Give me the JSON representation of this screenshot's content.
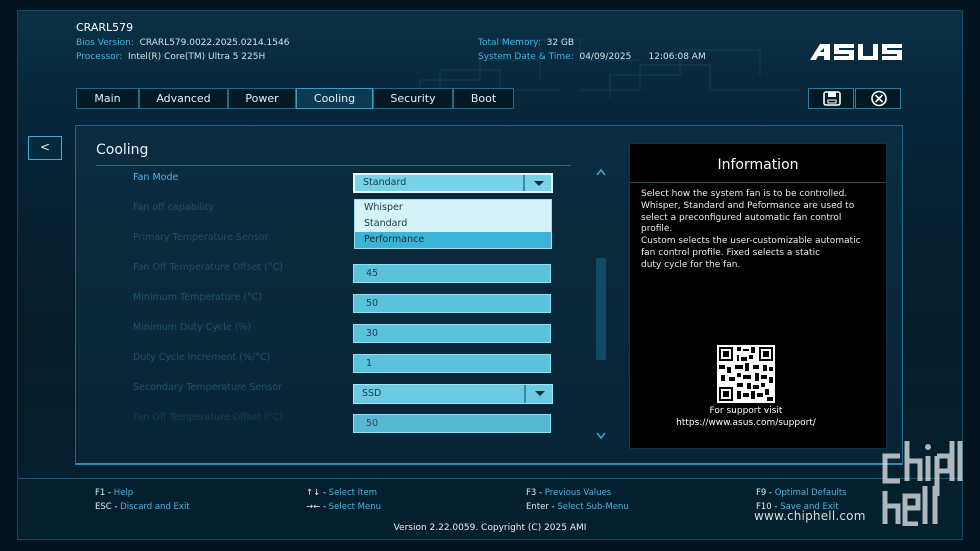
{
  "header": {
    "model": "CRARL579",
    "bios_version_label": "Bios Version:",
    "bios_version": "CRARL579.0022.2025.0214.1546",
    "processor_label": "Processor:",
    "processor": "Intel(R) Core(TM) Ultra 5 225H",
    "memory_label": "Total Memory:",
    "memory": "32 GB",
    "datetime_label": "System Date & Time:",
    "date": "04/09/2025",
    "time": "12:06:08 AM",
    "brand": "ASUS"
  },
  "tabs": [
    {
      "label": "Main"
    },
    {
      "label": "Advanced"
    },
    {
      "label": "Power"
    },
    {
      "label": "Cooling"
    },
    {
      "label": "Security"
    },
    {
      "label": "Boot"
    }
  ],
  "active_tab": "Cooling",
  "back_label": "<",
  "section": {
    "title": "Cooling",
    "rows": [
      {
        "label": "Fan Mode",
        "value": "Standard"
      },
      {
        "label": "Fan off capability",
        "value": ""
      },
      {
        "label": "Primary Temperature Sensor",
        "value": ""
      },
      {
        "label": "Fan Off Temperature Offset (°C)",
        "value": "45"
      },
      {
        "label": "Minimum Temperature (°C)",
        "value": "50"
      },
      {
        "label": "Minimum Duty Cycle (%)",
        "value": "30"
      },
      {
        "label": "Duty Cycle Increment (%/°C)",
        "value": "1"
      },
      {
        "label": "Secondary Temperature Sensor",
        "value": "SSD"
      },
      {
        "label": "Fan Off Temperature Offset (°C)",
        "value": "50"
      }
    ],
    "dropdown_options": [
      "Whisper",
      "Standard",
      "Performance"
    ],
    "highlighted_option": "Performance"
  },
  "info": {
    "title": "Information",
    "lines": [
      "Select how the system fan is to be controlled.",
      "Whisper, Standard and Peformance are used to",
      "select a preconfigured automatic fan control",
      "profile.",
      "Custom selects the user-customizable automatic",
      "fan control profile. Fixed selects a static",
      "duty cycle for the fan."
    ],
    "support_label": "For support visit",
    "support_url": "https://www.asus.com/support/"
  },
  "hotkeys": [
    {
      "key": "F1",
      "desc": "Help"
    },
    {
      "key": "ESC",
      "desc": "Discard and Exit"
    },
    {
      "key": "↑↓",
      "desc": "Select Item"
    },
    {
      "key": "→←",
      "desc": "Select Menu"
    },
    {
      "key": "F3",
      "desc": "Previous Values"
    },
    {
      "key": "Enter",
      "desc": "Select Sub-Menu"
    },
    {
      "key": "F9",
      "desc": "Optimal Defaults"
    },
    {
      "key": "F10",
      "desc": "Save and Exit"
    }
  ],
  "version": "Version 2.22.0059. Copyright (C) 2025 AMI",
  "watermark": "www.chiphell.com",
  "colors": {
    "accent": "#3fb6e4",
    "field": "#5bc2dc",
    "highlight": "#3ab5d8"
  }
}
